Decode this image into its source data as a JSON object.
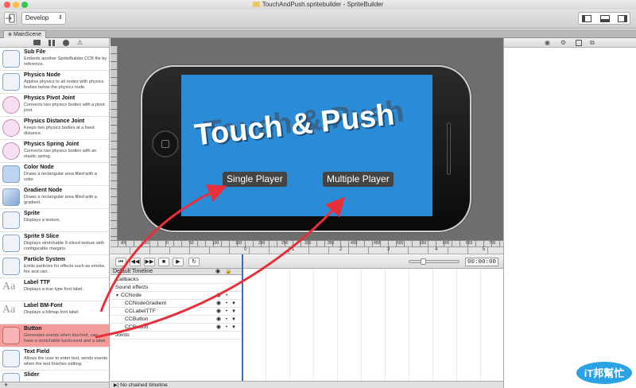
{
  "window": {
    "title": "TouchAndPush.spritebuilder - SpriteBuilder"
  },
  "toolbar": {
    "mode_select": "Develop"
  },
  "tab": {
    "label": "MainScene"
  },
  "library": {
    "items": [
      {
        "name": "Sub File",
        "desc": "Embeds another SpriteBuilder CCB file by reference.",
        "icon": "sub-file-icon"
      },
      {
        "name": "Physics Node",
        "desc": "Applies physics to all nodes with physics bodies below the physics node.",
        "icon": "physics-node-icon"
      },
      {
        "name": "Physics Pivot Joint",
        "desc": "Connects two physics bodies with a pivot joint.",
        "icon": "pivot-joint-icon"
      },
      {
        "name": "Physics Distance Joint",
        "desc": "Keeps two physics bodies at a fixed distance.",
        "icon": "distance-joint-icon"
      },
      {
        "name": "Physics Spring Joint",
        "desc": "Connects two physics bodies with an elastic spring.",
        "icon": "spring-joint-icon"
      },
      {
        "name": "Color Node",
        "desc": "Draws a rectangular area filled with a color.",
        "icon": "color-node-icon"
      },
      {
        "name": "Gradient Node",
        "desc": "Draws a rectangular area filled with a gradient.",
        "icon": "gradient-node-icon"
      },
      {
        "name": "Sprite",
        "desc": "Displays a texture.",
        "icon": "sprite-icon"
      },
      {
        "name": "Sprite 9 Slice",
        "desc": "Displays stretchable 9-sliced texture with configurable margins.",
        "icon": "sprite-9-slice-icon"
      },
      {
        "name": "Particle System",
        "desc": "Emits particles for effects such as smoke, fire and rain.",
        "icon": "particle-system-icon"
      },
      {
        "name": "Label TTF",
        "desc": "Displays a true type font label.",
        "icon": "label-ttf-icon"
      },
      {
        "name": "Label BM-Font",
        "desc": "Displays a bitmap font label.",
        "icon": "label-bmfont-icon"
      },
      {
        "name": "Button",
        "desc": "Generates events when touched, can have a stretchable backround and a label.",
        "icon": "button-icon"
      },
      {
        "name": "Text Field",
        "desc": "Allows the user to enter text, sends events when the text finishes editing.",
        "icon": "text-field-icon"
      },
      {
        "name": "Slider",
        "desc": "",
        "icon": "slider-icon"
      }
    ],
    "selected_index": 12,
    "add_label": "+"
  },
  "canvas": {
    "game_title": "Touch & Push",
    "buttons": {
      "single": "Single Player",
      "multi": "Multiple Player"
    },
    "ruler_labels": [
      "-85",
      "-50",
      "0",
      "50",
      "100",
      "150",
      "200",
      "250",
      "300",
      "350",
      "400",
      "450",
      "500",
      "550",
      "600",
      "650",
      "700"
    ]
  },
  "timeline": {
    "time": "00:00:00",
    "ruler_labels": [
      "0",
      "1",
      "2",
      "3",
      "4",
      "5"
    ],
    "header": "Default Timeline",
    "rows": [
      {
        "label": "Callbacks",
        "indent": 1
      },
      {
        "label": "Sound effects",
        "indent": 1
      },
      {
        "label": "CCNode",
        "indent": 1
      },
      {
        "label": "CCNodeGradient",
        "indent": 3
      },
      {
        "label": "CCLabelTTF",
        "indent": 3
      },
      {
        "label": "CCButton",
        "indent": 3
      },
      {
        "label": "CCButton",
        "indent": 3
      },
      {
        "label": "Joints",
        "indent": 1
      }
    ],
    "footer": "No chained timeline"
  },
  "watermark": {
    "text": "iT邦幫忙"
  },
  "colors": {
    "arrow": "#e8303a",
    "selected_row": "#f39c9c",
    "screen": "#2a8bd6"
  }
}
